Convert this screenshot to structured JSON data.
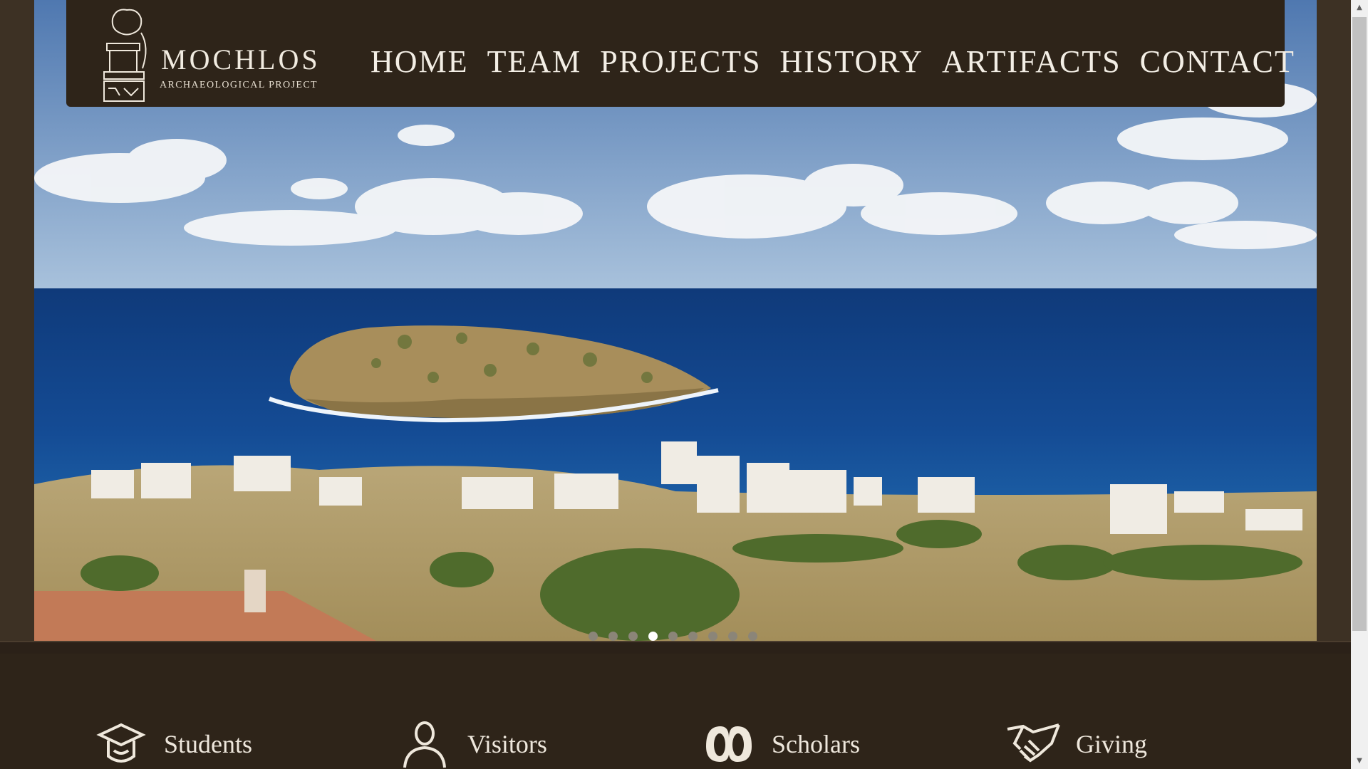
{
  "brand": {
    "title": "MOCHLOS",
    "subtitle": "ARCHAEOLOGICAL PROJECT"
  },
  "nav": {
    "items": [
      {
        "label": "HOME"
      },
      {
        "label": "TEAM"
      },
      {
        "label": "PROJECTS"
      },
      {
        "label": "HISTORY"
      },
      {
        "label": "ARTIFACTS"
      },
      {
        "label": "CONTACT"
      }
    ]
  },
  "slider": {
    "slide_count": 9,
    "active_slide": 4
  },
  "audiences": [
    {
      "label": "Students",
      "icon": "graduate-cap-icon"
    },
    {
      "label": "Visitors",
      "icon": "person-icon"
    },
    {
      "label": "Scholars",
      "icon": "scholars-icon"
    },
    {
      "label": "Giving",
      "icon": "handshake-icon"
    }
  ],
  "colors": {
    "header_bg": "#2e2419",
    "text_light": "#f3eee5",
    "sea": "#123f80",
    "sky": "#6f8fb8"
  }
}
